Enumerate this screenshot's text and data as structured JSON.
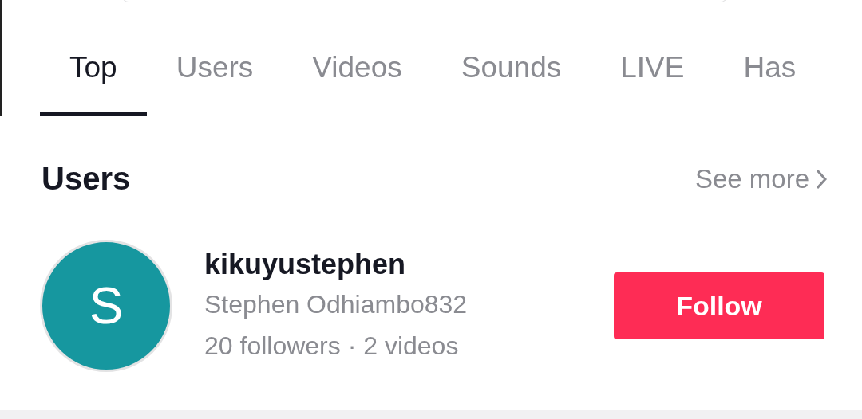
{
  "tabs": [
    {
      "label": "Top",
      "selected": true
    },
    {
      "label": "Users",
      "selected": false
    },
    {
      "label": "Videos",
      "selected": false
    },
    {
      "label": "Sounds",
      "selected": false
    },
    {
      "label": "LIVE",
      "selected": false
    },
    {
      "label": "Has",
      "selected": false
    }
  ],
  "users_section": {
    "title": "Users",
    "see_more": "See more",
    "users": [
      {
        "avatar_letter": "S",
        "color": "#16979f",
        "username": "kikuyustephen",
        "display_name": "Stephen Odhiambo832",
        "stats": "20 followers · 2 videos",
        "follow_label": "Follow"
      }
    ]
  }
}
